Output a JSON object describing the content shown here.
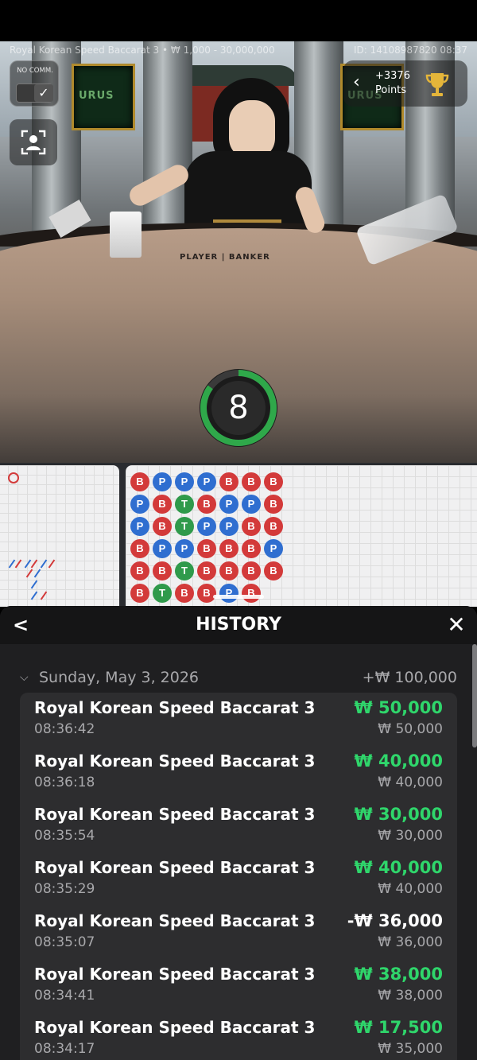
{
  "video": {
    "game_title": "Royal Korean Speed Baccarat 3 • ₩ 1,000 - 30,000,000",
    "game_id": "ID: 14108987820 08:37",
    "no_commission_label": "NO COMM.",
    "screen_logo": "URUS",
    "table_text": "PLAYER | BANKER",
    "points_value": "+3376",
    "points_label": "Points",
    "timer_value": "8",
    "timer_progress": 0.85
  },
  "bead_road": [
    [
      "B",
      "P",
      "P",
      "P",
      "B",
      "B",
      "B"
    ],
    [
      "P",
      "B",
      "T",
      "B",
      "P",
      "P",
      "B"
    ],
    [
      "P",
      "B",
      "T",
      "P",
      "P",
      "B",
      "B"
    ],
    [
      "B",
      "P",
      "P",
      "B",
      "B",
      "B",
      "P"
    ],
    [
      "B",
      "B",
      "T",
      "B",
      "B",
      "B",
      "B"
    ],
    [
      "B",
      "T",
      "B",
      "B",
      "P",
      "B",
      ""
    ]
  ],
  "history": {
    "title": "HISTORY",
    "date": "Sunday, May 3, 2026",
    "date_total": "+₩ 100,000",
    "items": [
      {
        "name": "Royal Korean Speed Baccarat 3",
        "time": "08:36:42",
        "amount": "₩ 50,000",
        "stake": "₩ 50,000",
        "result": "win"
      },
      {
        "name": "Royal Korean Speed Baccarat 3",
        "time": "08:36:18",
        "amount": "₩ 40,000",
        "stake": "₩ 40,000",
        "result": "win"
      },
      {
        "name": "Royal Korean Speed Baccarat 3",
        "time": "08:35:54",
        "amount": "₩ 30,000",
        "stake": "₩ 30,000",
        "result": "win"
      },
      {
        "name": "Royal Korean Speed Baccarat 3",
        "time": "08:35:29",
        "amount": "₩ 40,000",
        "stake": "₩ 40,000",
        "result": "win"
      },
      {
        "name": "Royal Korean Speed Baccarat 3",
        "time": "08:35:07",
        "amount": "-₩ 36,000",
        "stake": "₩ 36,000",
        "result": "loss"
      },
      {
        "name": "Royal Korean Speed Baccarat 3",
        "time": "08:34:41",
        "amount": "₩ 38,000",
        "stake": "₩ 38,000",
        "result": "win"
      },
      {
        "name": "Royal Korean Speed Baccarat 3",
        "time": "08:34:17",
        "amount": "₩ 17,500",
        "stake": "₩ 35,000",
        "result": "win"
      }
    ]
  },
  "colors": {
    "win": "#2fd66b",
    "banker": "#d33a3a",
    "player": "#2f6ed0",
    "tie": "#2f9a4b",
    "timer": "#2fa84a"
  }
}
